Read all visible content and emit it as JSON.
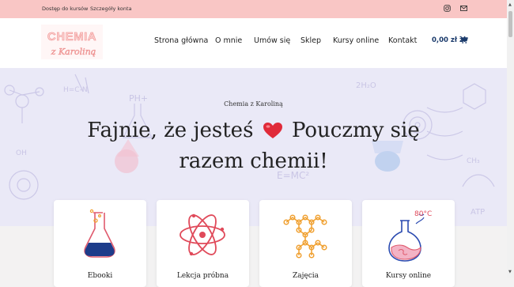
{
  "topbar": {
    "links": [
      "Dostęp do kursów",
      "Szczegóły konta"
    ],
    "icons": [
      "instagram-icon",
      "mail-icon"
    ],
    "background": "#f9c6c5"
  },
  "header": {
    "logo_text": [
      "CHEMIA",
      "z Karoliną"
    ],
    "nav": [
      "Strona główna",
      "O mnie",
      "Umów się",
      "Sklep",
      "Kursy online",
      "Kontakt"
    ],
    "cart_total": "0,00 zł zł",
    "cart_icon": "cart-icon",
    "accent": "#1a3a6b"
  },
  "hero": {
    "subtitle": "Chemia z Karoliną",
    "title_part1": "Fajnie, że jesteś",
    "title_part2": "Pouczmy się razem chemii!",
    "heart_icon": "heart-icon",
    "background": "#e9e6f6"
  },
  "cards": [
    {
      "label": "Ebooki",
      "icon": "flask-icon"
    },
    {
      "label": "Lekcja próbna",
      "icon": "atom-icon"
    },
    {
      "label": "Zajęcia",
      "icon": "molecule-icon"
    },
    {
      "label": "Kursy online",
      "icon": "heated-flask-icon"
    }
  ]
}
